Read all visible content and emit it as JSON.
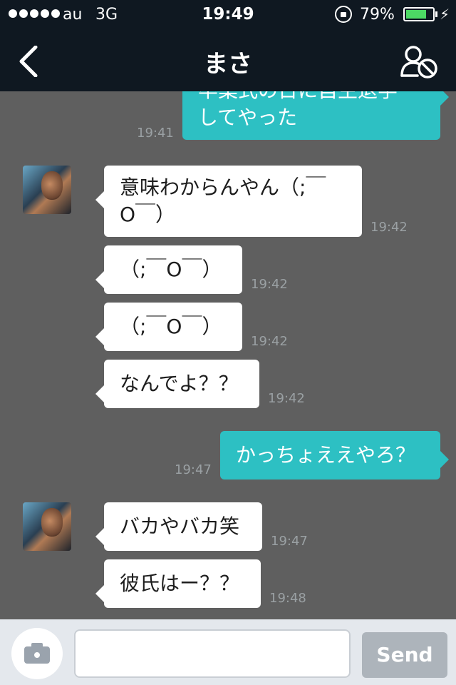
{
  "status_bar": {
    "carrier": "au",
    "network": "3G",
    "time": "19:49",
    "battery_percent": "79%",
    "battery_level": 0.79,
    "battery_color": "#4cd964"
  },
  "nav": {
    "back_icon": "chevron-left-icon",
    "title": "まさ",
    "right_icon": "block-user-icon"
  },
  "messages": [
    {
      "side": "right",
      "text_lines": [
        "卒業式の日に自主退学",
        "してやった"
      ],
      "time": "19:41"
    },
    {
      "side": "left",
      "avatar": true,
      "text_lines": [
        "意味わからんやん（;￣",
        "O￣）"
      ],
      "time": "19:42"
    },
    {
      "side": "left",
      "text_lines": [
        "（;￣O￣）"
      ],
      "time": "19:42"
    },
    {
      "side": "left",
      "text_lines": [
        "（;￣O￣）"
      ],
      "time": "19:42"
    },
    {
      "side": "left",
      "text_lines": [
        "なんでよ？？"
      ],
      "time": "19:42"
    },
    {
      "side": "right",
      "text_lines": [
        "かっちょええやろ？"
      ],
      "time": "19:47"
    },
    {
      "side": "left",
      "avatar": true,
      "text_lines": [
        "バカやバカ笑"
      ],
      "time": "19:47"
    },
    {
      "side": "left",
      "text_lines": [
        "彼氏はー？？"
      ],
      "time": "19:48"
    }
  ],
  "input_bar": {
    "camera_icon": "camera-icon",
    "message_value": "",
    "send_label": "Send"
  },
  "colors": {
    "chat_bg": "#5f5f5f",
    "topbar_bg": "#0f1821",
    "sent_bubble": "#2dc0c3",
    "received_bubble": "#ffffff"
  }
}
